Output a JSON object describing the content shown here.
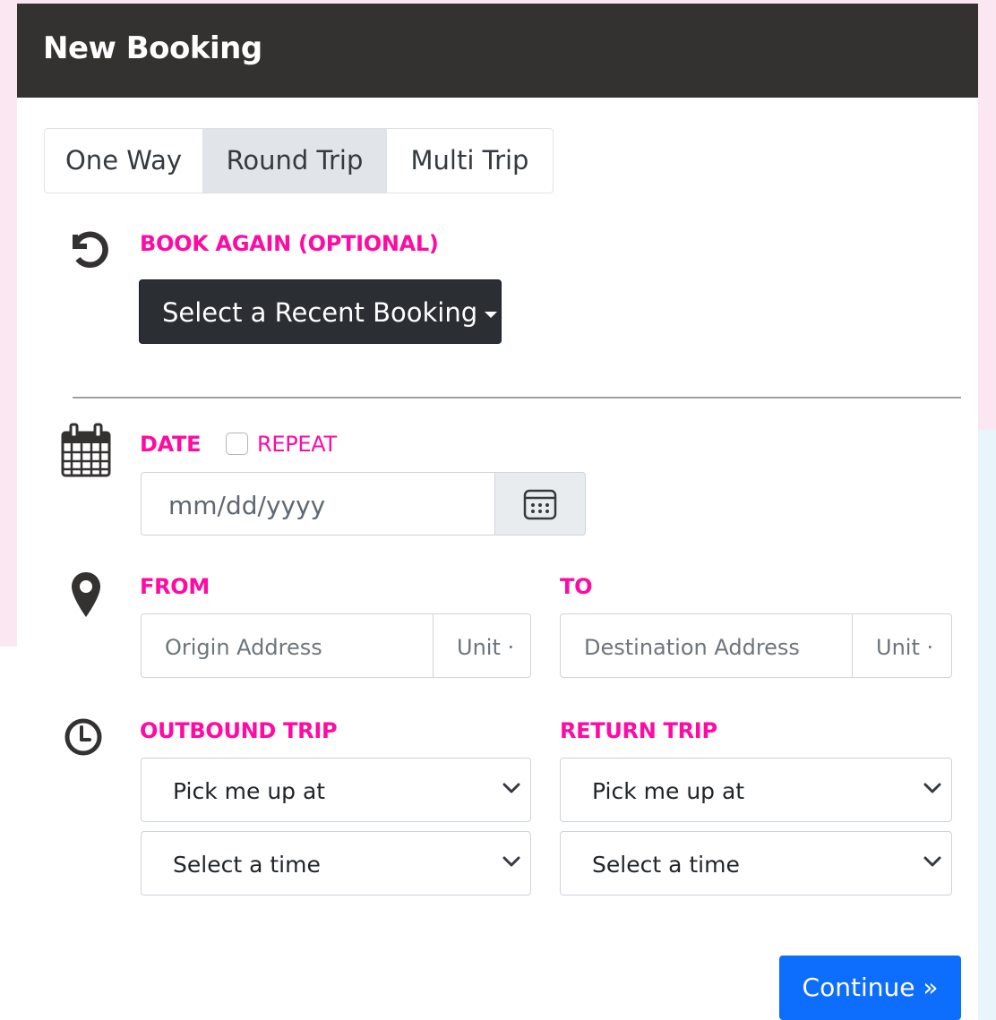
{
  "modal": {
    "title": "New Booking"
  },
  "trip_tabs": [
    {
      "label": "One Way",
      "active": false
    },
    {
      "label": "Round Trip",
      "active": true
    },
    {
      "label": "Multi Trip",
      "active": false
    }
  ],
  "book_again": {
    "label": "BOOK AGAIN (OPTIONAL)",
    "button_label": "Select a Recent Booking"
  },
  "date": {
    "label": "DATE",
    "repeat_label": "REPEAT",
    "repeat_checked": false,
    "placeholder": "mm/dd/yyyy"
  },
  "from": {
    "label": "FROM",
    "address_placeholder": "Origin Address",
    "unit_placeholder": "Unit ·"
  },
  "to": {
    "label": "TO",
    "address_placeholder": "Destination Address",
    "unit_placeholder": "Unit ·"
  },
  "outbound": {
    "label": "OUTBOUND TRIP",
    "pickup_select": "Pick me up at",
    "time_select": "Select a time"
  },
  "return": {
    "label": "RETURN TRIP",
    "pickup_select": "Pick me up at",
    "time_select": "Select a time"
  },
  "continue_label": "Continue »",
  "icons": {
    "book_again": "history-icon",
    "date": "calendar-icon",
    "date_picker": "calendar-alt-icon",
    "location": "map-marker-icon",
    "time": "clock-icon",
    "select": "chevron-down-icon"
  },
  "colors": {
    "accent_label": "#ff0aa2",
    "header_bg": "#343131",
    "primary_button": "#0d6efd",
    "dark_button": "#2b2f33"
  }
}
